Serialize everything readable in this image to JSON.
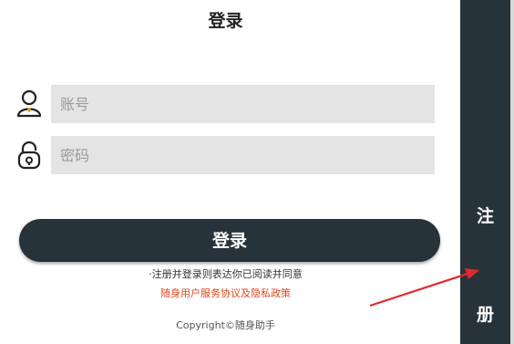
{
  "header": {
    "title": "登录"
  },
  "form": {
    "account_placeholder": "账号",
    "password_placeholder": "密码",
    "account_icon": "user-icon",
    "password_icon": "lock-icon"
  },
  "actions": {
    "login_label": "登录"
  },
  "agreement": {
    "notice": "·注册并登录则表达你已阅读并同意",
    "link": "随身用户服务协议及隐私政策"
  },
  "footer": {
    "copyright": "Copyright©随身助手"
  },
  "side_tab": {
    "char_top": "注",
    "char_bottom": "册"
  },
  "colors": {
    "primary_dark": "#27333a",
    "field_bg": "#e4e4e4",
    "link_orange": "#e0471c",
    "arrow_red": "#e02a2a"
  }
}
